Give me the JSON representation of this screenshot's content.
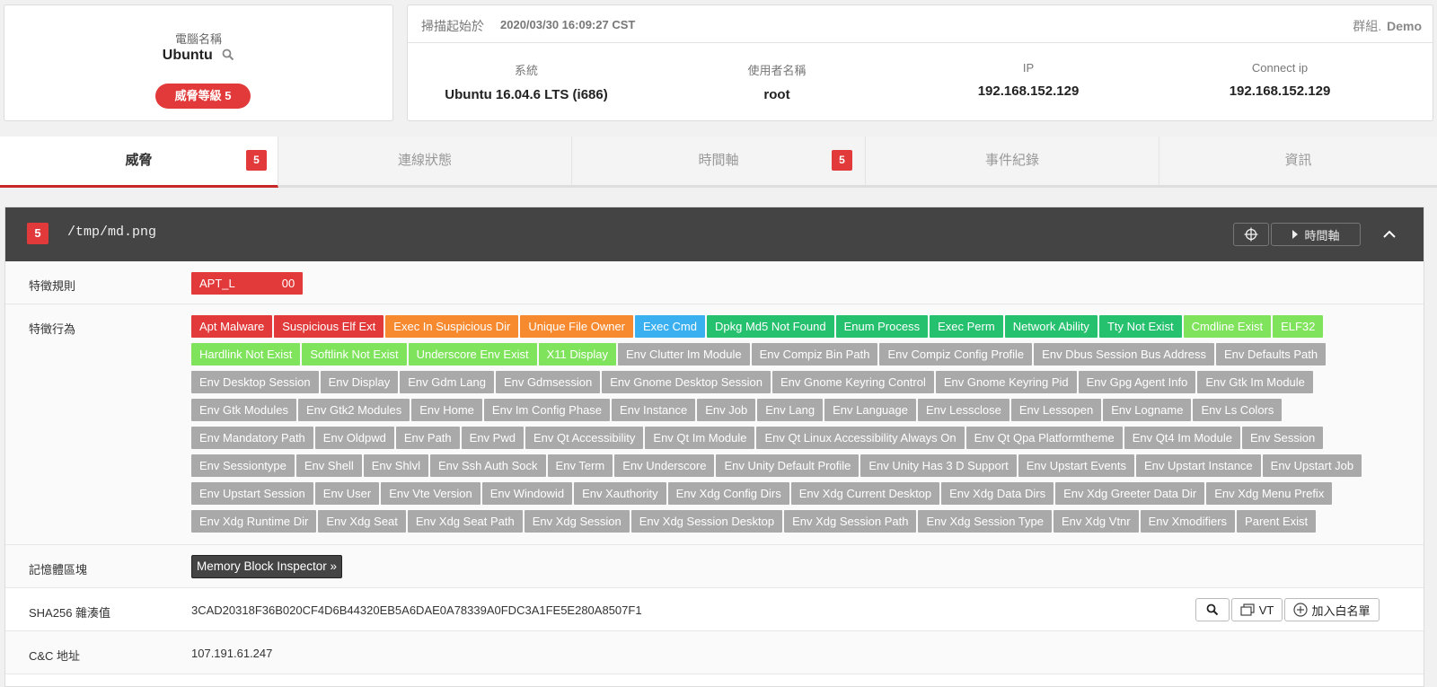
{
  "computer": {
    "name_label": "電腦名稱",
    "name": "Ubuntu",
    "threat_level": "威脅等級 5"
  },
  "system": {
    "scan_label": "掃描起始於",
    "scan_time": "2020/03/30 16:09:27 CST",
    "group_label": "群組.",
    "group_value": "Demo",
    "columns": [
      {
        "label": "系統",
        "value": "Ubuntu 16.04.6 LTS (i686)"
      },
      {
        "label": "使用者名稱",
        "value": "root"
      },
      {
        "label": "IP",
        "value": "192.168.152.129"
      },
      {
        "label": "Connect ip",
        "value": "192.168.152.129"
      }
    ]
  },
  "tabs": [
    {
      "label": "威脅",
      "badge": "5"
    },
    {
      "label": "連線狀態",
      "badge": ""
    },
    {
      "label": "時間軸",
      "badge": "5"
    },
    {
      "label": "事件紀錄",
      "badge": ""
    },
    {
      "label": "資訊",
      "badge": ""
    }
  ],
  "threat": {
    "badge": "5",
    "path": "/tmp/md.png",
    "timeline_button": "時間軸",
    "rule_label": "特徵規則",
    "rule_prefix": "APT_L",
    "rule_suffix": "00",
    "behavior_label": "特徵行為",
    "memory_label": "記憶體區塊",
    "memory_button": "Memory Block Inspector »",
    "sha_label": "SHA256 雜湊值",
    "sha_value": "3CAD20318F36B020CF4D6B44320EB5A6DAE0A78339A0FDC3A1FE5E280A8507F1",
    "vt_button": "VT",
    "whitelist_button": "加入白名單",
    "cc_label": "C&C 地址",
    "cc_value": "107.191.61.247"
  },
  "colors": {
    "red": "#e23a3a",
    "orange": "#f7892f",
    "blue": "#3ab0f0",
    "green": "#25c16f",
    "lightgreen": "#7fe35b",
    "gray": "#a9a9a9"
  },
  "behaviors": [
    {
      "label": "Apt Malware",
      "color": "red"
    },
    {
      "label": "Suspicious Elf Ext",
      "color": "red"
    },
    {
      "label": "Exec In Suspicious Dir",
      "color": "orange"
    },
    {
      "label": "Unique File Owner",
      "color": "orange"
    },
    {
      "label": "Exec Cmd",
      "color": "blue"
    },
    {
      "label": "Dpkg Md5 Not Found",
      "color": "green"
    },
    {
      "label": "Enum Process",
      "color": "green"
    },
    {
      "label": "Exec Perm",
      "color": "green"
    },
    {
      "label": "Network Ability",
      "color": "green"
    },
    {
      "label": "Tty Not Exist",
      "color": "green"
    },
    {
      "label": "Cmdline Exist",
      "color": "lightgreen"
    },
    {
      "label": "ELF32",
      "color": "lightgreen"
    },
    {
      "label": "Hardlink Not Exist",
      "color": "lightgreen"
    },
    {
      "label": "Softlink Not Exist",
      "color": "lightgreen"
    },
    {
      "label": "Underscore Env Exist",
      "color": "lightgreen"
    },
    {
      "label": "X11 Display",
      "color": "lightgreen"
    },
    {
      "label": "Env Clutter Im Module",
      "color": "gray"
    },
    {
      "label": "Env Compiz Bin Path",
      "color": "gray"
    },
    {
      "label": "Env Compiz Config Profile",
      "color": "gray"
    },
    {
      "label": "Env Dbus Session Bus Address",
      "color": "gray"
    },
    {
      "label": "Env Defaults Path",
      "color": "gray"
    },
    {
      "label": "Env Desktop Session",
      "color": "gray"
    },
    {
      "label": "Env Display",
      "color": "gray"
    },
    {
      "label": "Env Gdm Lang",
      "color": "gray"
    },
    {
      "label": "Env Gdmsession",
      "color": "gray"
    },
    {
      "label": "Env Gnome Desktop Session",
      "color": "gray"
    },
    {
      "label": "Env Gnome Keyring Control",
      "color": "gray"
    },
    {
      "label": "Env Gnome Keyring Pid",
      "color": "gray"
    },
    {
      "label": "Env Gpg Agent Info",
      "color": "gray"
    },
    {
      "label": "Env Gtk Im Module",
      "color": "gray"
    },
    {
      "label": "Env Gtk Modules",
      "color": "gray"
    },
    {
      "label": "Env Gtk2 Modules",
      "color": "gray"
    },
    {
      "label": "Env Home",
      "color": "gray"
    },
    {
      "label": "Env Im Config Phase",
      "color": "gray"
    },
    {
      "label": "Env Instance",
      "color": "gray"
    },
    {
      "label": "Env Job",
      "color": "gray"
    },
    {
      "label": "Env Lang",
      "color": "gray"
    },
    {
      "label": "Env Language",
      "color": "gray"
    },
    {
      "label": "Env Lessclose",
      "color": "gray"
    },
    {
      "label": "Env Lessopen",
      "color": "gray"
    },
    {
      "label": "Env Logname",
      "color": "gray"
    },
    {
      "label": "Env Ls Colors",
      "color": "gray"
    },
    {
      "label": "Env Mandatory Path",
      "color": "gray"
    },
    {
      "label": "Env Oldpwd",
      "color": "gray"
    },
    {
      "label": "Env Path",
      "color": "gray"
    },
    {
      "label": "Env Pwd",
      "color": "gray"
    },
    {
      "label": "Env Qt Accessibility",
      "color": "gray"
    },
    {
      "label": "Env Qt Im Module",
      "color": "gray"
    },
    {
      "label": "Env Qt Linux Accessibility Always On",
      "color": "gray"
    },
    {
      "label": "Env Qt Qpa Platformtheme",
      "color": "gray"
    },
    {
      "label": "Env Qt4 Im Module",
      "color": "gray"
    },
    {
      "label": "Env Session",
      "color": "gray"
    },
    {
      "label": "Env Sessiontype",
      "color": "gray"
    },
    {
      "label": "Env Shell",
      "color": "gray"
    },
    {
      "label": "Env Shlvl",
      "color": "gray"
    },
    {
      "label": "Env Ssh Auth Sock",
      "color": "gray"
    },
    {
      "label": "Env Term",
      "color": "gray"
    },
    {
      "label": "Env Underscore",
      "color": "gray"
    },
    {
      "label": "Env Unity Default Profile",
      "color": "gray"
    },
    {
      "label": "Env Unity Has 3 D Support",
      "color": "gray"
    },
    {
      "label": "Env Upstart Events",
      "color": "gray"
    },
    {
      "label": "Env Upstart Instance",
      "color": "gray"
    },
    {
      "label": "Env Upstart Job",
      "color": "gray"
    },
    {
      "label": "Env Upstart Session",
      "color": "gray"
    },
    {
      "label": "Env User",
      "color": "gray"
    },
    {
      "label": "Env Vte Version",
      "color": "gray"
    },
    {
      "label": "Env Windowid",
      "color": "gray"
    },
    {
      "label": "Env Xauthority",
      "color": "gray"
    },
    {
      "label": "Env Xdg Config Dirs",
      "color": "gray"
    },
    {
      "label": "Env Xdg Current Desktop",
      "color": "gray"
    },
    {
      "label": "Env Xdg Data Dirs",
      "color": "gray"
    },
    {
      "label": "Env Xdg Greeter Data Dir",
      "color": "gray"
    },
    {
      "label": "Env Xdg Menu Prefix",
      "color": "gray"
    },
    {
      "label": "Env Xdg Runtime Dir",
      "color": "gray"
    },
    {
      "label": "Env Xdg Seat",
      "color": "gray"
    },
    {
      "label": "Env Xdg Seat Path",
      "color": "gray"
    },
    {
      "label": "Env Xdg Session",
      "color": "gray"
    },
    {
      "label": "Env Xdg Session Desktop",
      "color": "gray"
    },
    {
      "label": "Env Xdg Session Path",
      "color": "gray"
    },
    {
      "label": "Env Xdg Session Type",
      "color": "gray"
    },
    {
      "label": "Env Xdg Vtnr",
      "color": "gray"
    },
    {
      "label": "Env Xmodifiers",
      "color": "gray"
    },
    {
      "label": "Parent Exist",
      "color": "gray"
    }
  ],
  "icons": [
    "search-icon",
    "crosshair-icon",
    "caret-right-icon",
    "chevron-up-icon",
    "copy-icon",
    "plus-circle-icon"
  ]
}
